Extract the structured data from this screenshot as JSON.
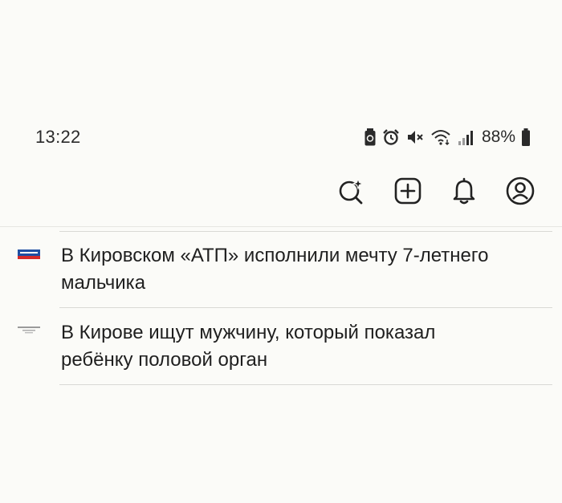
{
  "status_bar": {
    "time": "13:22",
    "battery_percent": "88%",
    "icons": [
      "battery-saver-icon",
      "alarm-icon",
      "mute-icon",
      "wifi-icon",
      "signal-icon",
      "battery-icon"
    ]
  },
  "toolbar": {
    "buttons": [
      "ai-search-icon",
      "add-icon",
      "bell-icon",
      "profile-icon"
    ]
  },
  "news": {
    "items": [
      {
        "source_icon": "russia-tv-logo-icon",
        "headline": "В Кировском «АТП» исполнили мечту 7-летнего мальчика"
      },
      {
        "source_icon": "news-source-logo-icon",
        "headline": "В Кирове ищут мужчину, который показал ребёнку половой орган"
      }
    ]
  },
  "colors": {
    "background": "#fbfbf8",
    "text": "#1f1f1f",
    "divider": "#d9d9d5",
    "russia_logo_blue": "#1f4fa3",
    "russia_logo_red": "#d52b2b"
  }
}
